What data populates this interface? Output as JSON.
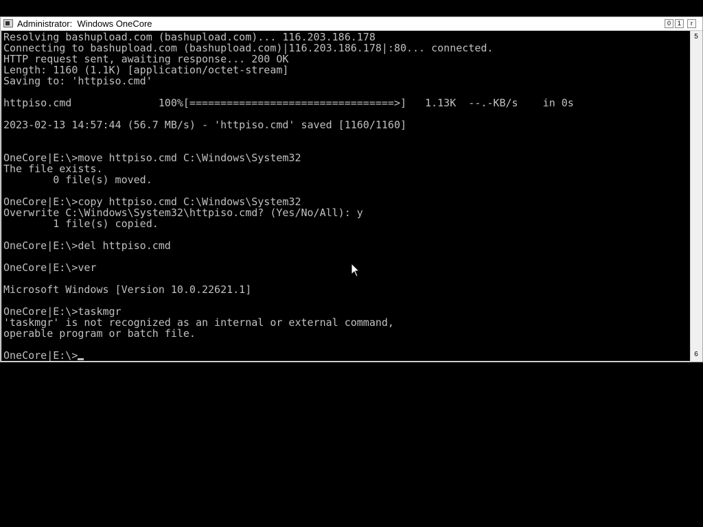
{
  "window": {
    "title": "Administrator:  Windows OneCore",
    "buttons": {
      "minimize": "0",
      "maximize": "1",
      "close": "r"
    }
  },
  "scrollbar": {
    "up_glyph": "5",
    "down_glyph": "6"
  },
  "console": {
    "lines": [
      "Resolving bashupload.com (bashupload.com)... 116.203.186.178",
      "Connecting to bashupload.com (bashupload.com)|116.203.186.178|:80... connected.",
      "HTTP request sent, awaiting response... 200 OK",
      "Length: 1160 (1.1K) [application/octet-stream]",
      "Saving to: 'httpiso.cmd'",
      "",
      "httpiso.cmd              100%[=================================>]   1.13K  --.-KB/s    in 0s",
      "",
      "2023-02-13 14:57:44 (56.7 MB/s) - 'httpiso.cmd' saved [1160/1160]",
      "",
      "",
      "OneCore|E:\\>move httpiso.cmd C:\\Windows\\System32",
      "The file exists.",
      "        0 file(s) moved.",
      "",
      "OneCore|E:\\>copy httpiso.cmd C:\\Windows\\System32",
      "Overwrite C:\\Windows\\System32\\httpiso.cmd? (Yes/No/All): y",
      "        1 file(s) copied.",
      "",
      "OneCore|E:\\>del httpiso.cmd",
      "",
      "OneCore|E:\\>ver",
      "",
      "Microsoft Windows [Version 10.0.22621.1]",
      "",
      "OneCore|E:\\>taskmgr",
      "'taskmgr' is not recognized as an internal or external command,",
      "operable program or batch file.",
      ""
    ],
    "prompt": "OneCore|E:\\>"
  },
  "icons": {
    "window_icon": "console-window-icon",
    "pointer": "mouse-pointer-icon"
  }
}
